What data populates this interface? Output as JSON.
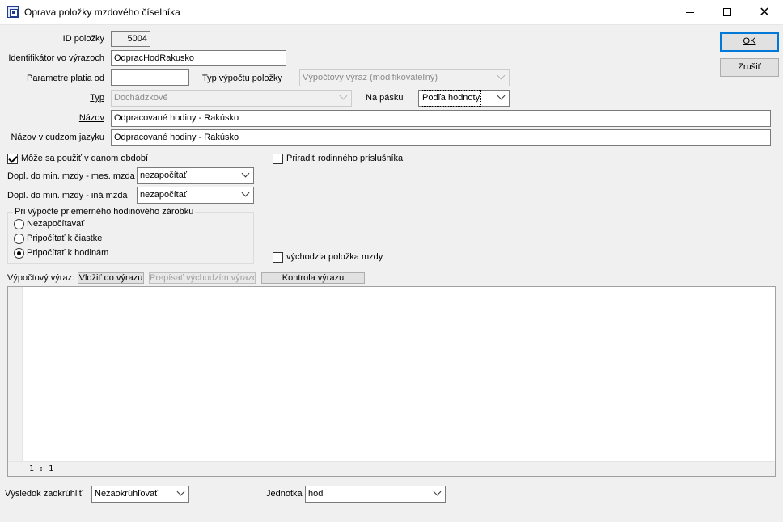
{
  "window": {
    "title": "Oprava položky mzdového číselníka"
  },
  "buttons": {
    "ok": "OK",
    "cancel": "Zrušiť"
  },
  "fields": {
    "id_label": "ID položky",
    "id_value": "5004",
    "identifier_label": "Identifikátor vo výrazoch",
    "identifier_value": "OdpracHodRakusko",
    "valid_from_label": "Parametre platia od",
    "valid_from_value": "",
    "calc_type_label": "Typ výpočtu položky",
    "calc_type_value": "Výpočtový výraz (modifikovateľný)",
    "type_label": "Typ",
    "type_value": "Dochádzkové",
    "payslip_label": "Na pásku",
    "payslip_value": "Podľa hodnoty",
    "name_label": "Názov",
    "name_value": "Odpracované hodiny - Rakúsko",
    "foreign_name_label": "Názov v cudzom jazyku",
    "foreign_name_value": "Odpracované hodiny - Rakúsko"
  },
  "options": {
    "usable_in_period_label": "Môže sa použiť v danom období",
    "usable_in_period_checked": true,
    "assign_family_member_label": "Priradiť rodinného príslušníka",
    "assign_family_member_checked": false,
    "min_wage_monthly_label": "Dopl. do min. mzdy - mes. mzda",
    "min_wage_monthly_value": "nezapočítať",
    "min_wage_other_label": "Dopl. do min. mzdy - iná mzda",
    "min_wage_other_value": "nezapočítať",
    "avg_earnings_group_title": "Pri výpočte priemerného hodinového zárobku",
    "avg_earnings_options": [
      "Nezapočítavať",
      "Pripočítať k čiastke",
      "Pripočítať k hodinám"
    ],
    "avg_earnings_selected": 2,
    "default_wage_item_label": "východzia položka mzdy",
    "default_wage_item_checked": false
  },
  "expression": {
    "label": "Výpočtový výraz:",
    "insert_button": "Vložiť do výrazu",
    "rewrite_button": "Prepísať východzím výrazom",
    "check_button": "Kontrola výrazu",
    "content": "",
    "cursor_position": "1 : 1"
  },
  "footer": {
    "rounding_label": "Výsledok zaokrúhliť",
    "rounding_value": "Nezaokrúhľovať",
    "unit_label": "Jednotka",
    "unit_value": "hod"
  }
}
